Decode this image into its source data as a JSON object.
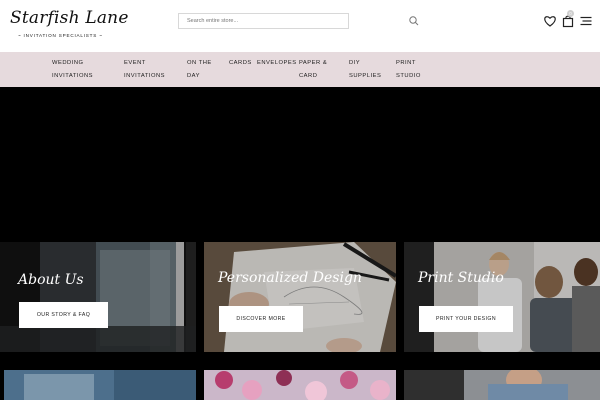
{
  "brand": {
    "name": "Starfish Lane",
    "tagline": "~ INVITATION SPECIALISTS ~"
  },
  "search": {
    "placeholder": "Search entire store..."
  },
  "cart": {
    "count": "0"
  },
  "nav": {
    "items": [
      {
        "label": "WEDDING INVITATIONS"
      },
      {
        "label": "EVENT INVITATIONS"
      },
      {
        "label": "ON THE DAY"
      },
      {
        "label": "CARDS"
      },
      {
        "label": "ENVELOPES"
      },
      {
        "label": "PAPER & CARD"
      },
      {
        "label": "DIY SUPPLIES"
      },
      {
        "label": "PRINT STUDIO"
      }
    ]
  },
  "tiles": [
    {
      "title": "About Us",
      "button": "OUR STORY & FAQ"
    },
    {
      "title": "Personalized Design",
      "button": "DISCOVER MORE"
    },
    {
      "title": "Print Studio",
      "button": "PRINT YOUR DESIGN"
    }
  ],
  "colors": {
    "nav_bg": "#e6dadd",
    "hero_bg": "#000000",
    "header_bg": "#ffffff"
  }
}
